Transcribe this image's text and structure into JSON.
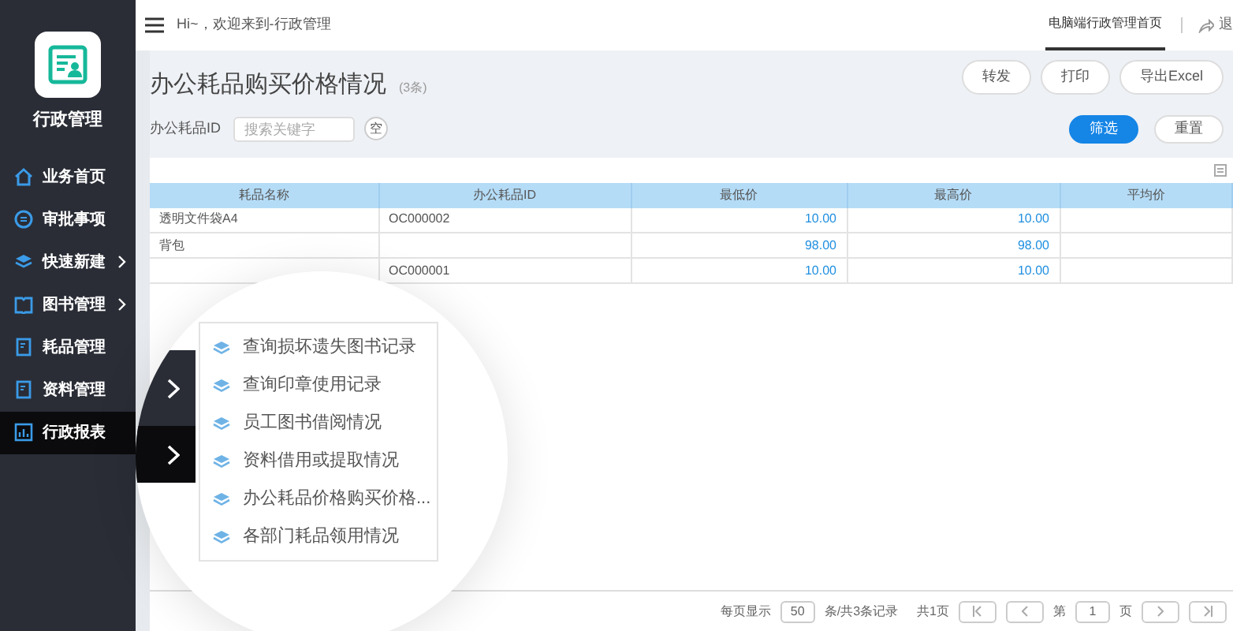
{
  "app": {
    "name": "行政管理"
  },
  "sidebar": {
    "items": [
      {
        "label": "业务首页",
        "selected": false,
        "has_submenu": false
      },
      {
        "label": "审批事项",
        "selected": false,
        "has_submenu": false
      },
      {
        "label": "快速新建",
        "selected": false,
        "has_submenu": true
      },
      {
        "label": "图书管理",
        "selected": false,
        "has_submenu": true
      },
      {
        "label": "耗品管理",
        "selected": false,
        "has_submenu": false
      },
      {
        "label": "资料管理",
        "selected": false,
        "has_submenu": false
      },
      {
        "label": "行政报表",
        "selected": true,
        "has_submenu": false
      }
    ]
  },
  "topbar": {
    "greeting": "Hi~，欢迎来到-行政管理",
    "tabs": [
      {
        "label": "电脑端行政管理首页",
        "selected": true
      }
    ],
    "logout": "退"
  },
  "page": {
    "title": "办公耗品购买价格情况",
    "count": "(3条)",
    "actions": [
      "转发",
      "打印",
      "导出Excel"
    ]
  },
  "filter": {
    "label": "办公耗品ID",
    "placeholder": "搜索关键字",
    "clear": "空",
    "buttons": [
      {
        "label": "筛选",
        "kind": "primary"
      },
      {
        "label": "重置",
        "kind": "default"
      }
    ]
  },
  "table": {
    "columns": [
      "耗品名称",
      "办公耗品ID",
      "最低价",
      "最高价",
      "平均价"
    ],
    "rows": [
      {
        "name": "透明文件袋A4",
        "id": "OC000002",
        "min": "10.00",
        "max": "10.00"
      },
      {
        "name": "背包",
        "min": "98.00",
        "max": "98.00"
      },
      {
        "id": "OC000001",
        "min": "10.00",
        "max": "10.00"
      }
    ]
  },
  "submenu": {
    "items": [
      "查询损坏遗失图书记录",
      "查询印章使用记录",
      "员工图书借阅情况",
      "资料借用或提取情况",
      "办公耗品价格购买价格...",
      "各部门耗品领用情况"
    ]
  },
  "pagination": {
    "per_page_label": "每页显示",
    "per_page": "50",
    "summary": "条/共3条记录",
    "pages": "共1页",
    "page_prefix": "第",
    "page": "1",
    "page_suffix": "页"
  }
}
